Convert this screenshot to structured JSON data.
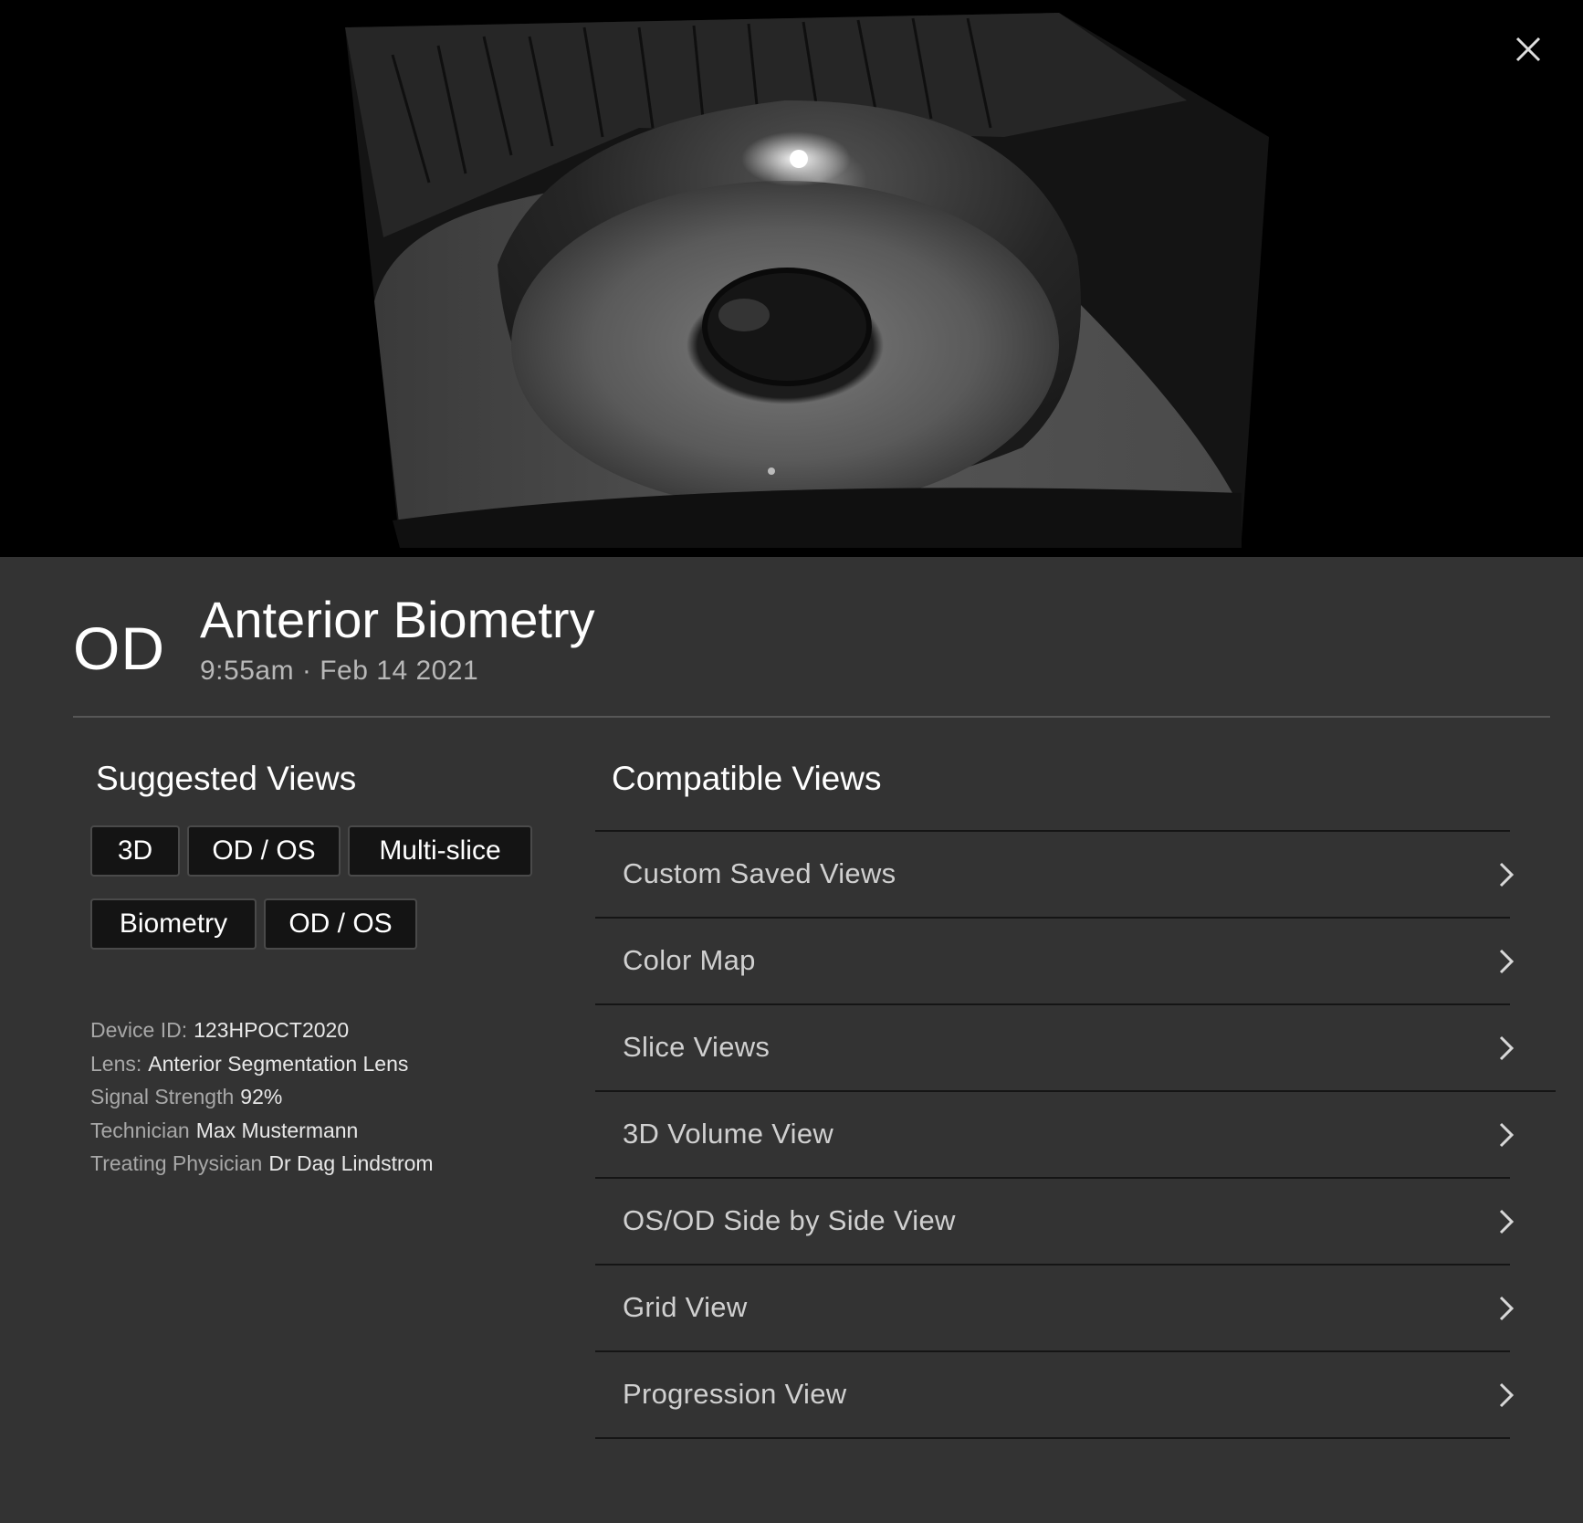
{
  "header": {
    "eye": "OD",
    "title": "Anterior Biometry",
    "timestamp": "9:55am · Feb 14 2021"
  },
  "suggested": {
    "heading": "Suggested Views",
    "chips": [
      "3D",
      "OD / OS",
      "Multi-slice",
      "Biometry",
      "OD / OS"
    ]
  },
  "meta": [
    {
      "label": "Device ID:",
      "value": "123HPOCT2020"
    },
    {
      "label": "Lens:",
      "value": "Anterior Segmentation Lens"
    },
    {
      "label": "Signal Strength",
      "value": "92%"
    },
    {
      "label": "Technician",
      "value": "Max Mustermann"
    },
    {
      "label": "Treating Physician",
      "value": "Dr Dag Lindstrom"
    }
  ],
  "compatible": {
    "heading": "Compatible Views",
    "items": [
      "Custom Saved  Views",
      "Color Map",
      "Slice Views",
      "3D Volume View",
      "OS/OD Side by Side View",
      "Grid View",
      "Progression View"
    ]
  },
  "icons": {
    "close": "close-icon",
    "chevron": "chevron-right-icon"
  },
  "colors": {
    "panel": "#333333",
    "hero": "#000000",
    "chip_bg": "#141414"
  }
}
